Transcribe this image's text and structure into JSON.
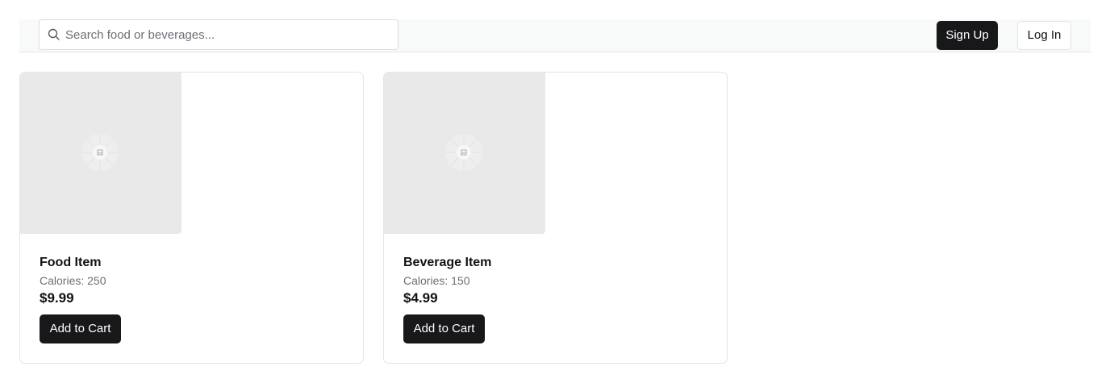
{
  "header": {
    "search": {
      "placeholder": "Search food or beverages...",
      "value": ""
    },
    "signup_label": "Sign Up",
    "login_label": "Log In"
  },
  "products": [
    {
      "name": "Food Item",
      "calories": "Calories: 250",
      "price": "$9.99",
      "button_label": "Add to Cart",
      "image_icon": "image-placeholder-icon"
    },
    {
      "name": "Beverage Item",
      "calories": "Calories: 150",
      "price": "$4.99",
      "button_label": "Add to Cart",
      "image_icon": "image-placeholder-icon"
    }
  ],
  "colors": {
    "primary_button": "#18181b",
    "header_bg": "#f8f9f9",
    "image_placeholder_bg": "#e9e9e9",
    "muted_text": "#6b6f75"
  }
}
